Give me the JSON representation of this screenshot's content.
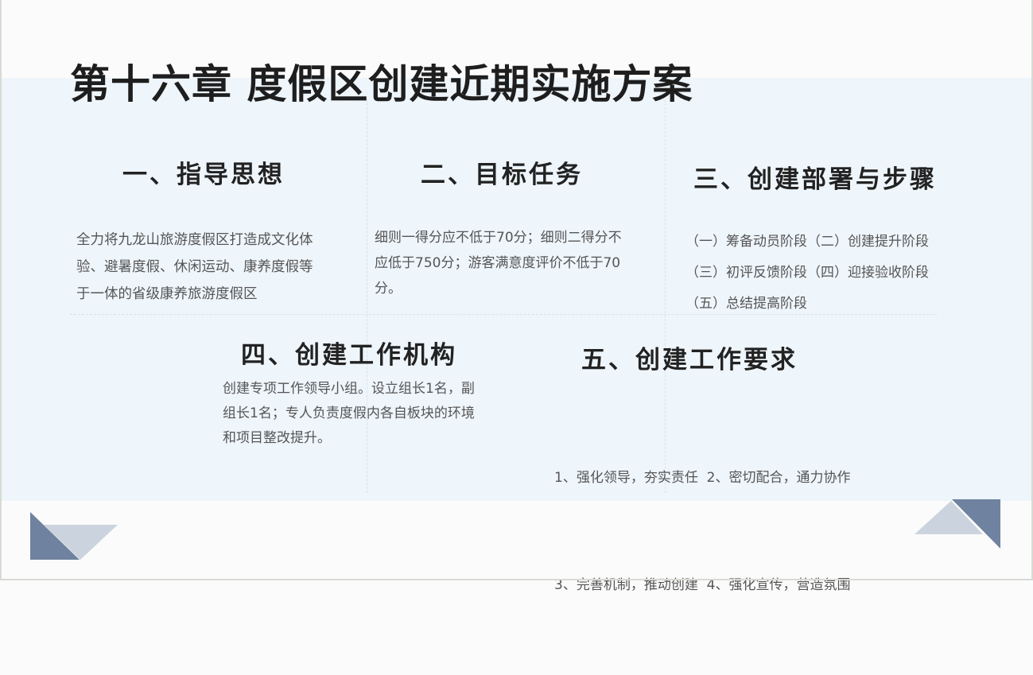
{
  "title": "第十六章 度假区创建近期实施方案",
  "sections": [
    {
      "heading": "一、指导思想",
      "body": [
        "全力将九龙山旅游度假区打造成文化体",
        "验、避暑度假、休闲运动、康养度假等",
        "于一体的省级康养旅游度假区"
      ]
    },
    {
      "heading": "二、目标任务",
      "body": [
        "细则一得分应不低于70分；细则二得分不",
        "应低于750分；游客满意度评价不低于70",
        "分。"
      ]
    },
    {
      "heading": "三、创建部署与步骤",
      "body": [
        "（一）筹备动员阶段（二）创建提升阶段",
        "（三）初评反馈阶段（四）迎接验收阶段",
        "（五）总结提高阶段"
      ]
    },
    {
      "heading": "四、创建工作机构",
      "body": [
        "创建专项工作领导小组。设立组长1名，副",
        "组长1名；专人负责度假内各自板块的环境",
        "和项目整改提升。"
      ]
    },
    {
      "heading": "五、创建工作要求",
      "body": [
        "1、强化领导，夯实责任  2、密切配合，通力协作",
        "3、完善机制，推动创建  4、强化宣传，营造氛围"
      ]
    }
  ],
  "colors": {
    "band": "#eef5fb",
    "accent_dark": "#6f829f",
    "accent_light": "#cbd4de"
  }
}
